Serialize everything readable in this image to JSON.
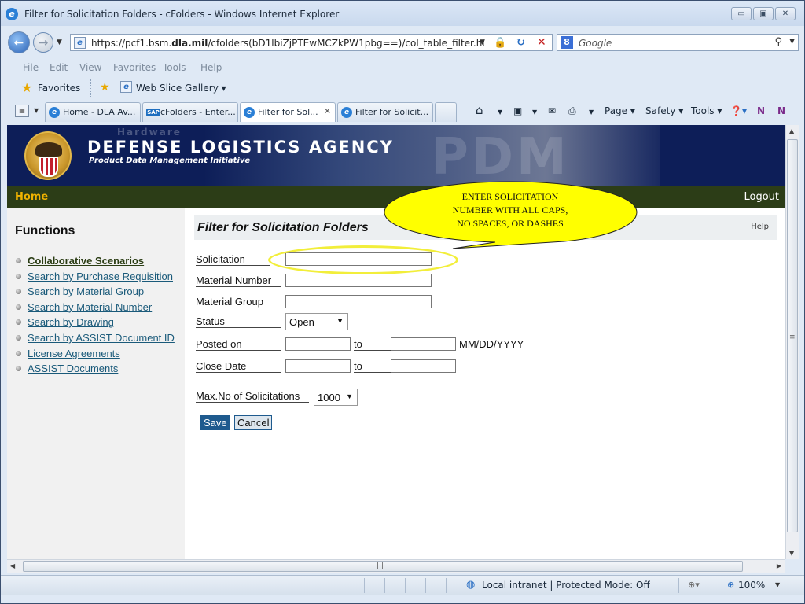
{
  "window": {
    "title": "Filter for Solicitation Folders - cFolders - Windows Internet Explorer",
    "minimize": "▭",
    "maximize": "▣",
    "close": "✕"
  },
  "address": {
    "url_pre": "https://pcf1.bsm.",
    "url_bold": "dla.mil",
    "url_post": "/cfolders(bD1lbiZjPTEwMCZkPW1pbg==)/col_table_filter.htm?p"
  },
  "search": {
    "placeholder": "Google"
  },
  "menu": [
    "File",
    "Edit",
    "View",
    "Favorites",
    "Tools",
    "Help"
  ],
  "favorites": {
    "label": "Favorites",
    "web_slice": "Web Slice Gallery ▾"
  },
  "tabs": [
    {
      "label": "Home - DLA Av..."
    },
    {
      "label": "cFolders - Enter..."
    },
    {
      "label": "Filter for Sol..."
    },
    {
      "label": "Filter for Solicit..."
    }
  ],
  "commands": {
    "page": "Page ▾",
    "safety": "Safety ▾",
    "tools": "Tools ▾"
  },
  "banner": {
    "agency": "DEFENSE LOGISTICS AGENCY",
    "subtitle": "Product Data Management Initiative",
    "watermark_small": "Hardware",
    "watermark_big": "PDM"
  },
  "nav": {
    "home": "Home",
    "logout": "Logout"
  },
  "functions": {
    "title": "Functions",
    "items": [
      "Collaborative Scenarios",
      "Search by Purchase Requisition",
      "Search by Material Group",
      "Search by Material Number",
      "Search by Drawing",
      "Search by ASSIST Document ID",
      "License Agreements",
      "ASSIST Documents"
    ]
  },
  "filter": {
    "title": "Filter for Solicitation Folders",
    "help": "Help",
    "solicitation_label": "Solicitation",
    "solicitation_value": "",
    "material_number_label": "Material Number",
    "material_number_value": "",
    "material_group_label": "Material Group",
    "material_group_value": "",
    "status_label": "Status",
    "status_value": "Open",
    "posted_on_label": "Posted on",
    "to_label": "to",
    "date_format": "MM/DD/YYYY",
    "close_date_label": "Close Date",
    "max_label": "Max.No of Solicitations",
    "max_value": "1000",
    "save": "Save",
    "cancel": "Cancel"
  },
  "callout": {
    "line1": "ENTER SOLICITATION",
    "line2": "NUMBER WITH ALL CAPS,",
    "line3": "NO SPACES, OR DASHES",
    "fill": "#ffff00",
    "stroke": "#222222"
  },
  "status": {
    "zone": "Local intranet | Protected Mode: Off",
    "zoom": "100%"
  },
  "colors": {
    "banner": "#0d1e58",
    "greenbar": "#2c3d17",
    "home_accent": "#f0b200",
    "link": "#1a5a7a",
    "save_button": "#1e5a8e",
    "highlight": "#f2ee3a"
  }
}
